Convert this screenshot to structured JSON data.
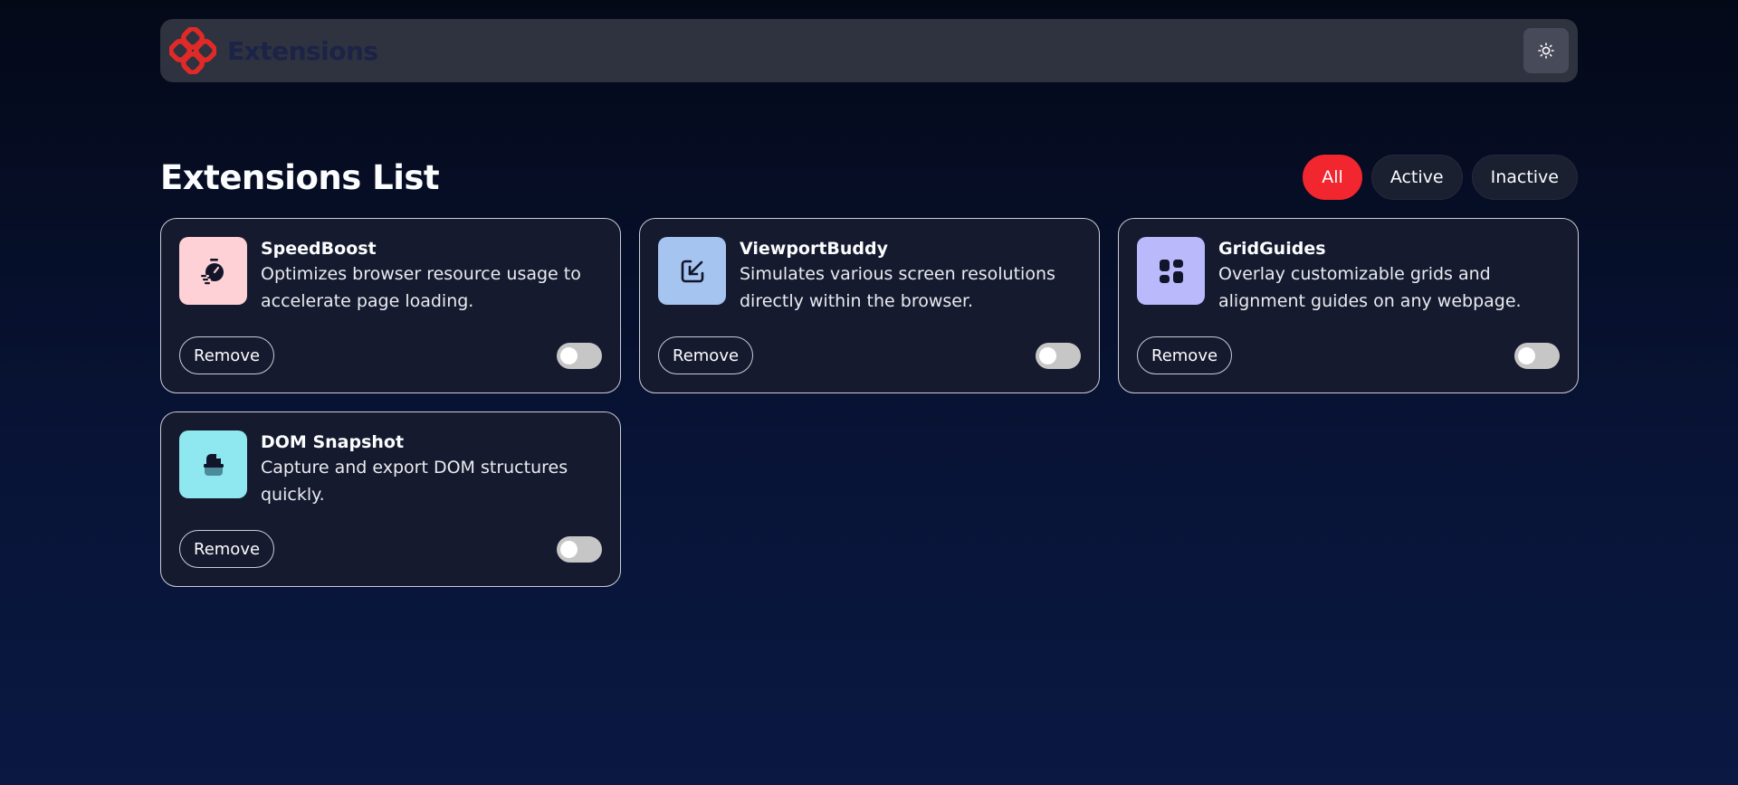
{
  "header": {
    "title": "Extensions",
    "logo_icon": "extensions-logo-icon",
    "theme_icon": "sun-icon",
    "accent_color": "#e02a27"
  },
  "list": {
    "title": "Extensions List",
    "filters": [
      {
        "label": "All",
        "active": true
      },
      {
        "label": "Active",
        "active": false
      },
      {
        "label": "Inactive",
        "active": false
      }
    ]
  },
  "extensions": [
    {
      "name": "SpeedBoost",
      "description": "Optimizes browser resource usage to accelerate page loading.",
      "icon": "stopwatch-icon",
      "icon_bg": "#fdd1d5",
      "remove_label": "Remove",
      "enabled": false
    },
    {
      "name": "ViewportBuddy",
      "description": "Simulates various screen resolutions directly within the browser.",
      "icon": "external-arrow-icon",
      "icon_bg": "#a5c4ef",
      "remove_label": "Remove",
      "enabled": false
    },
    {
      "name": "GridGuides",
      "description": "Overlay customizable grids and alignment guides on any webpage.",
      "icon": "layout-grid-icon",
      "icon_bg": "#b9b9fb",
      "remove_label": "Remove",
      "enabled": false
    },
    {
      "name": "DOM Snapshot",
      "description": "Capture and export DOM structures quickly.",
      "icon": "snapshot-cup-icon",
      "icon_bg": "#8fe8ef",
      "remove_label": "Remove",
      "enabled": false
    }
  ]
}
